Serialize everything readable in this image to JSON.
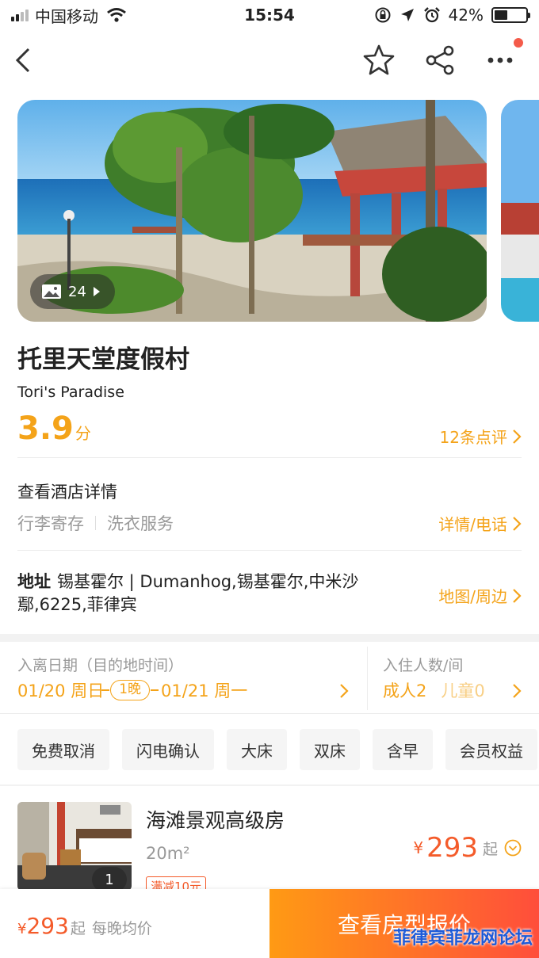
{
  "status": {
    "carrier": "中国移动",
    "time": "15:54",
    "battery": "42%",
    "battery_level": 0.42
  },
  "gallery": {
    "photo_count": "24"
  },
  "hotel": {
    "name": "托里天堂度假村",
    "name_en": "Tori's Paradise",
    "score": "3.9",
    "score_unit": "分",
    "reviews_link": "12条点评"
  },
  "details": {
    "title": "查看酒店详情",
    "facilities": [
      "行李寄存",
      "洗衣服务"
    ],
    "link": "详情/电话"
  },
  "address": {
    "label": "地址",
    "text": "锡基霍尔 | Dumanhog,锡基霍尔,中米沙鄢,6225,菲律宾",
    "link": "地图/周边"
  },
  "dates": {
    "label": "入离日期（目的地时间）",
    "checkin": "01/20 周日",
    "nights": "1晚",
    "checkout": "01/21 周一"
  },
  "guests": {
    "label": "入住人数/间",
    "adults": "成人2",
    "children": "儿童0"
  },
  "filters": [
    "免费取消",
    "闪电确认",
    "大床",
    "双床",
    "含早",
    "会员权益"
  ],
  "room": {
    "name": "海滩景观高级房",
    "size": "20m²",
    "promo": "满减10元",
    "photo_count": "1",
    "currency": "¥",
    "price": "293",
    "price_suffix": "起"
  },
  "bottom": {
    "currency": "¥",
    "price": "293",
    "price_suffix": "起",
    "note": "每晚均价",
    "cta": "查看房型报价"
  },
  "watermark": "菲律宾菲龙网论坛",
  "colors": {
    "accent": "#f4a319",
    "price": "#f45b2a",
    "cta_start": "#ff9a14",
    "cta_end": "#ff4e3b"
  }
}
